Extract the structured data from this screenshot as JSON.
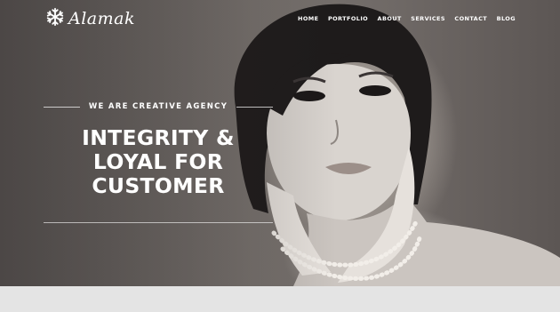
{
  "brand": {
    "name": "Alamak",
    "icon": "snowflake-icon"
  },
  "nav": {
    "items": [
      {
        "label": "HOME"
      },
      {
        "label": "PORTFOLIO"
      },
      {
        "label": "ABOUT"
      },
      {
        "label": "SERVICES"
      },
      {
        "label": "CONTACT"
      },
      {
        "label": "BLOG"
      }
    ]
  },
  "hero": {
    "tagline": "WE ARE CREATIVE AGENCY",
    "headline_lines": [
      "INTEGRITY &",
      "LOYAL FOR",
      "CUSTOMER"
    ]
  },
  "colors": {
    "text": "#ffffff",
    "footer_strip": "#e4e4e4"
  }
}
